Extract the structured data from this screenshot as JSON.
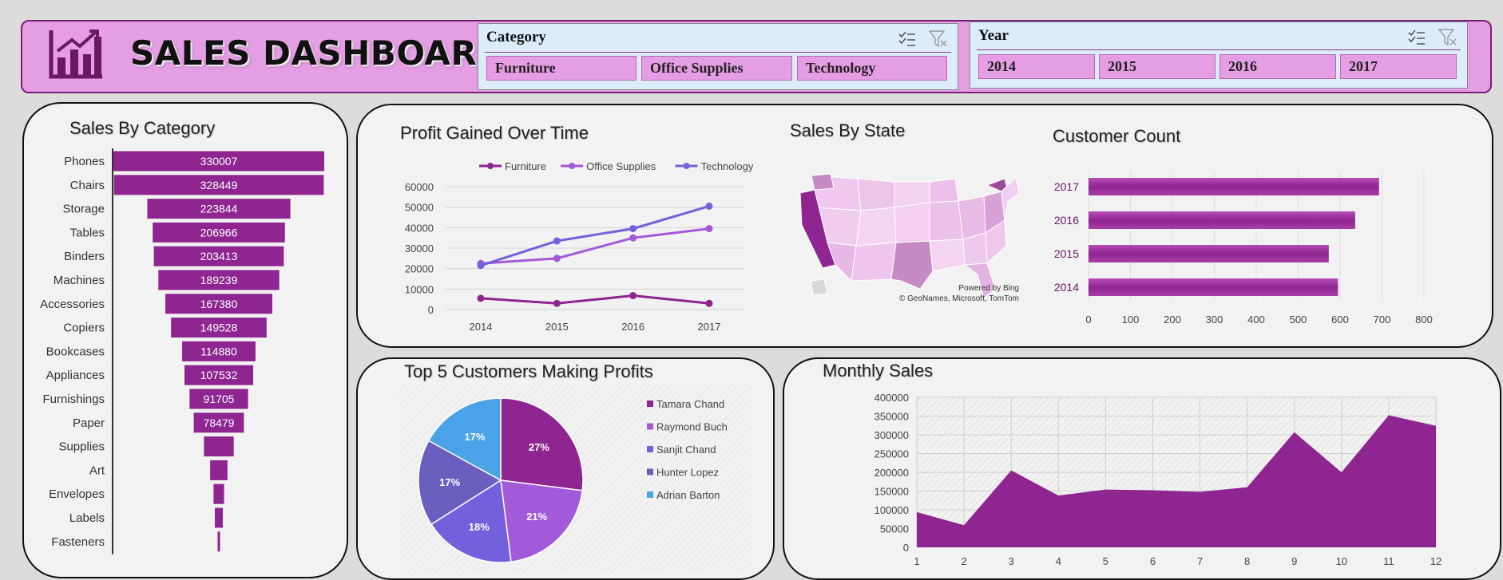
{
  "header": {
    "title": "SALES DASHBOARD",
    "icon": "bar-chart-growth-icon"
  },
  "slicers": {
    "category": {
      "title": "Category",
      "items": [
        "Furniture",
        "Office Supplies",
        "Technology"
      ]
    },
    "year": {
      "title": "Year",
      "items": [
        "2014",
        "2015",
        "2016",
        "2017"
      ]
    }
  },
  "colors": {
    "purple": "#8e2590",
    "light_purple": "#a25ad8",
    "violet": "#7360dc",
    "slicer_pink": "#e59de3",
    "slicer_bg": "#dcecf8"
  },
  "chart_data": [
    {
      "id": "sales_by_category",
      "type": "bar",
      "title": "Sales By Category",
      "orientation": "horizontal-funnel",
      "categories": [
        "Phones",
        "Chairs",
        "Storage",
        "Tables",
        "Binders",
        "Machines",
        "Accessories",
        "Copiers",
        "Bookcases",
        "Appliances",
        "Furnishings",
        "Paper",
        "Supplies",
        "Art",
        "Envelopes",
        "Labels",
        "Fasteners"
      ],
      "values": [
        330007,
        328449,
        223844,
        206966,
        203413,
        189239,
        167380,
        149528,
        114880,
        107532,
        91705,
        78479,
        46674,
        27119,
        16476,
        12486,
        3024
      ],
      "value_labels": [
        "330007",
        "328449",
        "223844",
        "206966",
        "203413",
        "189239",
        "167380",
        "149528",
        "114880",
        "107532",
        "91705",
        "78479",
        "",
        "",
        "",
        "",
        ""
      ]
    },
    {
      "id": "profit_over_time",
      "type": "line",
      "title": "Profit Gained Over Time",
      "x": [
        "2014",
        "2015",
        "2016",
        "2017"
      ],
      "series": [
        {
          "name": "Furniture",
          "values": [
            5500,
            3000,
            6800,
            3000
          ]
        },
        {
          "name": "Office Supplies",
          "values": [
            22500,
            25000,
            35000,
            39500
          ]
        },
        {
          "name": "Technology",
          "values": [
            21500,
            33500,
            39500,
            50500
          ]
        }
      ],
      "ylim": [
        0,
        60000
      ],
      "yticks": [
        "60000",
        "50000",
        "40000",
        "30000",
        "20000",
        "10000",
        "0"
      ],
      "legend": "top"
    },
    {
      "id": "sales_by_state",
      "type": "map",
      "title": "Sales By State",
      "credits": [
        "Powered by Bing",
        "© GeoNames, Microsoft, TomTom"
      ]
    },
    {
      "id": "customer_count",
      "type": "bar",
      "title": "Customer Count",
      "orientation": "horizontal",
      "categories": [
        "2017",
        "2016",
        "2015",
        "2014"
      ],
      "values": [
        693,
        636,
        573,
        595
      ],
      "xlim": [
        0,
        800
      ],
      "xticks": [
        "0",
        "100",
        "200",
        "300",
        "400",
        "500",
        "600",
        "700",
        "800"
      ]
    },
    {
      "id": "top5_customers",
      "type": "pie",
      "title": "Top 5 Customers Making Profits",
      "labels": [
        "Tamara Chand",
        "Raymond Buch",
        "Sanjit Chand",
        "Hunter Lopez",
        "Adrian Barton"
      ],
      "values": [
        27,
        21,
        18,
        17,
        17
      ],
      "value_labels": [
        "27%",
        "21%",
        "18%",
        "17%",
        "17%"
      ],
      "colors": [
        "#8e2590",
        "#a25ad8",
        "#7360dc",
        "#6a5fbe",
        "#4aa3e8"
      ],
      "legend": "right"
    },
    {
      "id": "monthly_sales",
      "type": "area",
      "title": "Monthly Sales",
      "x": [
        "1",
        "2",
        "3",
        "4",
        "5",
        "6",
        "7",
        "8",
        "9",
        "10",
        "11",
        "12"
      ],
      "values": [
        94000,
        59000,
        205000,
        138000,
        154000,
        152000,
        148000,
        160000,
        307000,
        200000,
        352000,
        324000
      ],
      "ylim": [
        0,
        400000
      ],
      "yticks": [
        "400000",
        "350000",
        "300000",
        "250000",
        "200000",
        "150000",
        "100000",
        "50000",
        "0"
      ]
    }
  ]
}
